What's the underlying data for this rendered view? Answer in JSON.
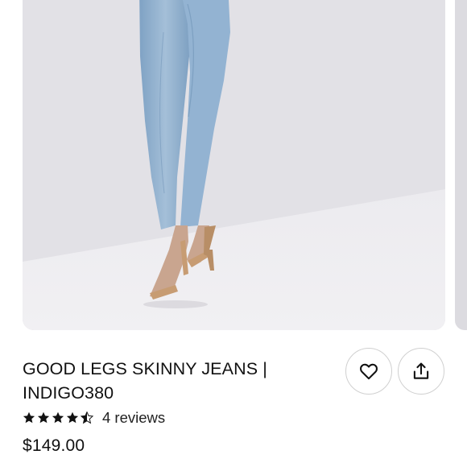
{
  "product": {
    "title_line1": "GOOD LEGS SKINNY JEANS |",
    "title_line2": "INDIGO380",
    "rating": 4.5,
    "rating_max": 5,
    "reviews_label": "4 reviews",
    "price": "$149.00"
  },
  "actions": {
    "favorite_icon": "heart-outline-icon",
    "share_icon": "share-upload-icon"
  },
  "colors": {
    "star": "#111111",
    "border": "#d0d0d0",
    "backdrop": "#e2e1e6",
    "denim": "#8fb0cf"
  }
}
